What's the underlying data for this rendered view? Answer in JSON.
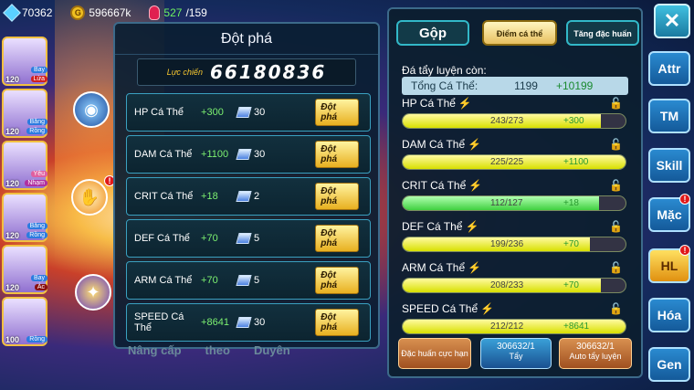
{
  "topbar": {
    "gems": "70362",
    "gold": "596667k",
    "stamina": "527",
    "stamina_max": "/159"
  },
  "roster": [
    {
      "lv": "120",
      "tag1": "Bay",
      "tag2": "Lửa"
    },
    {
      "lv": "120",
      "tag1": "Băng",
      "tag2": "Rồng"
    },
    {
      "lv": "120",
      "tag1": "Yêu",
      "tag2": "Nhạm"
    },
    {
      "lv": "120",
      "tag1": "Băng",
      "tag2": "Rồng"
    },
    {
      "lv": "120",
      "tag1": "Bay",
      "tag2": "Ác"
    },
    {
      "lv": "100",
      "tag1": "",
      "tag2": "Rồng"
    }
  ],
  "breakthrough": {
    "title": "Đột phá",
    "power_label": "Lực chiến",
    "power_value": "66180836",
    "rows": [
      {
        "name": "HP Cá Thể",
        "add": "+300",
        "cost": "30",
        "button": "Đột phá"
      },
      {
        "name": "DAM Cá Thể",
        "add": "+1100",
        "cost": "30",
        "button": "Đột phá"
      },
      {
        "name": "CRIT Cá Thể",
        "add": "+18",
        "cost": "2",
        "button": "Đột phá"
      },
      {
        "name": "DEF Cá Thể",
        "add": "+70",
        "cost": "5",
        "button": "Đột phá"
      },
      {
        "name": "ARM Cá Thể",
        "add": "+70",
        "cost": "5",
        "button": "Đột phá"
      },
      {
        "name": "SPEED Cá Thể",
        "add": "+8641",
        "cost": "30",
        "button": "Đột phá"
      }
    ]
  },
  "stats": {
    "tabs": [
      "Gộp",
      "Điểm cá thể",
      "Tăng đặc huấn"
    ],
    "remaining_label": "Đá tẩy luyện còn:",
    "total_label": "Tổng Cá Thể:",
    "total_value": "1199",
    "total_bonus": "+10199",
    "rows": [
      {
        "name": "HP Cá Thể",
        "value": "243/273",
        "bonus": "+300",
        "fill": 0.89
      },
      {
        "name": "DAM Cá Thể",
        "value": "225/225",
        "bonus": "+1100",
        "fill": 1.0
      },
      {
        "name": "CRIT Cá Thể",
        "value": "112/127",
        "bonus": "+18",
        "fill": 0.88
      },
      {
        "name": "DEF Cá Thể",
        "value": "199/236",
        "bonus": "+70",
        "fill": 0.84
      },
      {
        "name": "ARM Cá Thể",
        "value": "208/233",
        "bonus": "+70",
        "fill": 0.89
      },
      {
        "name": "SPEED Cá Thể",
        "value": "212/212",
        "bonus": "+8641",
        "fill": 1.0
      }
    ],
    "btn_special": "Đặc huấn cực hạn",
    "btn_wash_count": "306632/1",
    "btn_wash": "Tẩy",
    "btn_auto_count": "306632/1",
    "btn_auto": "Auto tẩy luyện"
  },
  "side_nav": [
    "Attr",
    "TM",
    "Skill",
    "Mặc",
    "HL",
    "Hóa",
    "Gen"
  ],
  "bottom_nav": [
    "Nâng cấp",
    "theo",
    "Duyên"
  ],
  "colors": {
    "accent": "#32b8c8",
    "gold": "#f8c830",
    "bonus": "#7cf070"
  }
}
